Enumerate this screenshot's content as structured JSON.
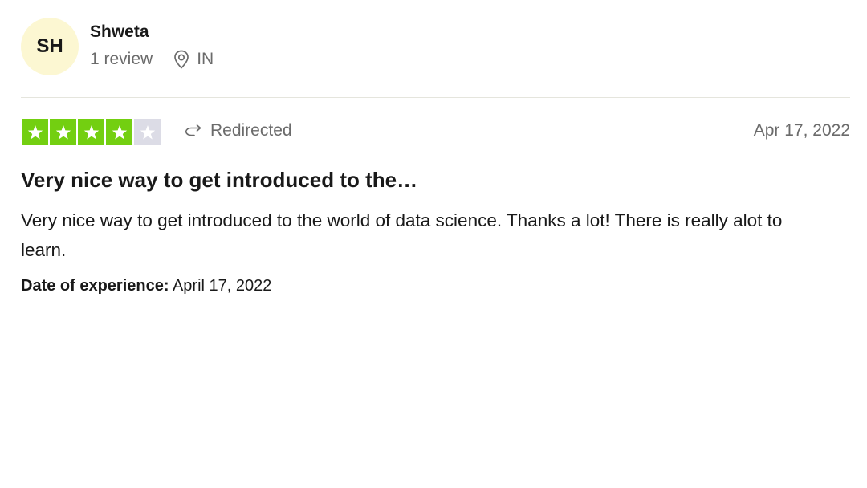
{
  "reviewer": {
    "initials": "SH",
    "name": "Shweta",
    "review_count": "1 review",
    "country": "IN"
  },
  "rating": {
    "value": 4,
    "max": 5,
    "filled_color": "#73cf11",
    "empty_color": "#dcdce6"
  },
  "status": {
    "label": "Redirected",
    "icon": "redirect-arrow-icon"
  },
  "review": {
    "date": "Apr 17, 2022",
    "title": "Very nice way to get introduced to the…",
    "body": "Very nice way to get introduced to the world of data science. Thanks a lot! There is really alot to learn.",
    "experience_label": "Date of experience:",
    "experience_date": "April 17, 2022"
  },
  "icons": {
    "location": "location-pin-icon",
    "star": "star-icon"
  }
}
